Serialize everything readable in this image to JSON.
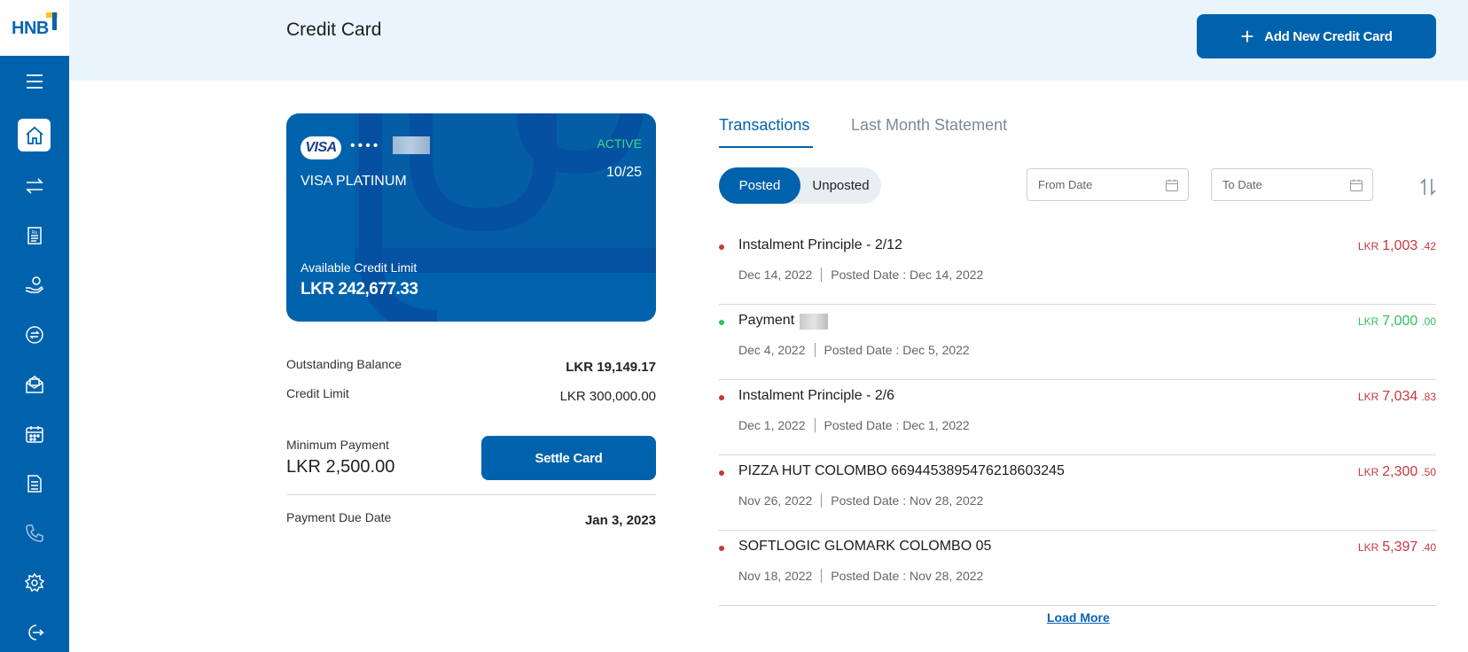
{
  "brand": {
    "logo": "HNB",
    "primary": "#0062ad",
    "accent_yellow": "#f6c61a"
  },
  "sidebar": {
    "items": [
      {
        "name": "menu-icon"
      },
      {
        "name": "home-icon",
        "active": true
      },
      {
        "name": "transfer-icon"
      },
      {
        "name": "bill-icon"
      },
      {
        "name": "hand-coin-icon"
      },
      {
        "name": "exchange-icon"
      },
      {
        "name": "mail-icon"
      },
      {
        "name": "calendar-icon"
      },
      {
        "name": "document-icon"
      },
      {
        "name": "phone-icon"
      },
      {
        "name": "gear-icon"
      },
      {
        "name": "logout-icon"
      }
    ]
  },
  "header": {
    "title": "Credit Card",
    "add_button": "Add New Credit Card"
  },
  "card": {
    "brand": "VISA",
    "masked_dots": "••••",
    "status": "ACTIVE",
    "name": "VISA PLATINUM",
    "expiry": "10/25",
    "available_label": "Available Credit Limit",
    "available_value": "LKR 242,677.33"
  },
  "summary": {
    "outstanding_label": "Outstanding Balance",
    "outstanding_value": "LKR 19,149.17",
    "limit_label": "Credit Limit",
    "limit_value": "LKR 300,000.00",
    "min_label": "Minimum Payment",
    "min_value": "LKR 2,500.00",
    "settle_button": "Settle Card",
    "due_label": "Payment Due Date",
    "due_value": "Jan 3, 2023"
  },
  "tabs": [
    {
      "label": "Transactions",
      "active": true
    },
    {
      "label": "Last Month Statement",
      "active": false
    }
  ],
  "filter": {
    "posted": "Posted",
    "unposted": "Unposted",
    "from_placeholder": "From Date",
    "to_placeholder": "To Date"
  },
  "transactions": [
    {
      "title": "Instalment Principle - 2/12",
      "date": "Dec 14, 2022",
      "posted": "Posted Date : Dec 14, 2022",
      "currency": "LKR",
      "amount": "1,003",
      "cents": ".42",
      "type": "debit"
    },
    {
      "title": "Payment",
      "date": "Dec 4, 2022",
      "posted": "Posted Date : Dec 5, 2022",
      "currency": "LKR",
      "amount": "7,000",
      "cents": ".00",
      "type": "credit"
    },
    {
      "title": "Instalment Principle - 2/6",
      "date": "Dec 1, 2022",
      "posted": "Posted Date : Dec 1, 2022",
      "currency": "LKR",
      "amount": "7,034",
      "cents": ".83",
      "type": "debit"
    },
    {
      "title": "PIZZA HUT COLOMBO 6694453895476218603245",
      "date": "Nov 26, 2022",
      "posted": "Posted Date : Nov 28, 2022",
      "currency": "LKR",
      "amount": "2,300",
      "cents": ".50",
      "type": "debit"
    },
    {
      "title": "SOFTLOGIC GLOMARK COLOMBO 05",
      "date": "Nov 18, 2022",
      "posted": "Posted Date : Nov 28, 2022",
      "currency": "LKR",
      "amount": "5,397",
      "cents": ".40",
      "type": "debit"
    }
  ],
  "load_more": "Load More",
  "colors": {
    "debit": "#c6383f",
    "credit": "#2fbf5e",
    "status_active": "#3ddc84"
  }
}
